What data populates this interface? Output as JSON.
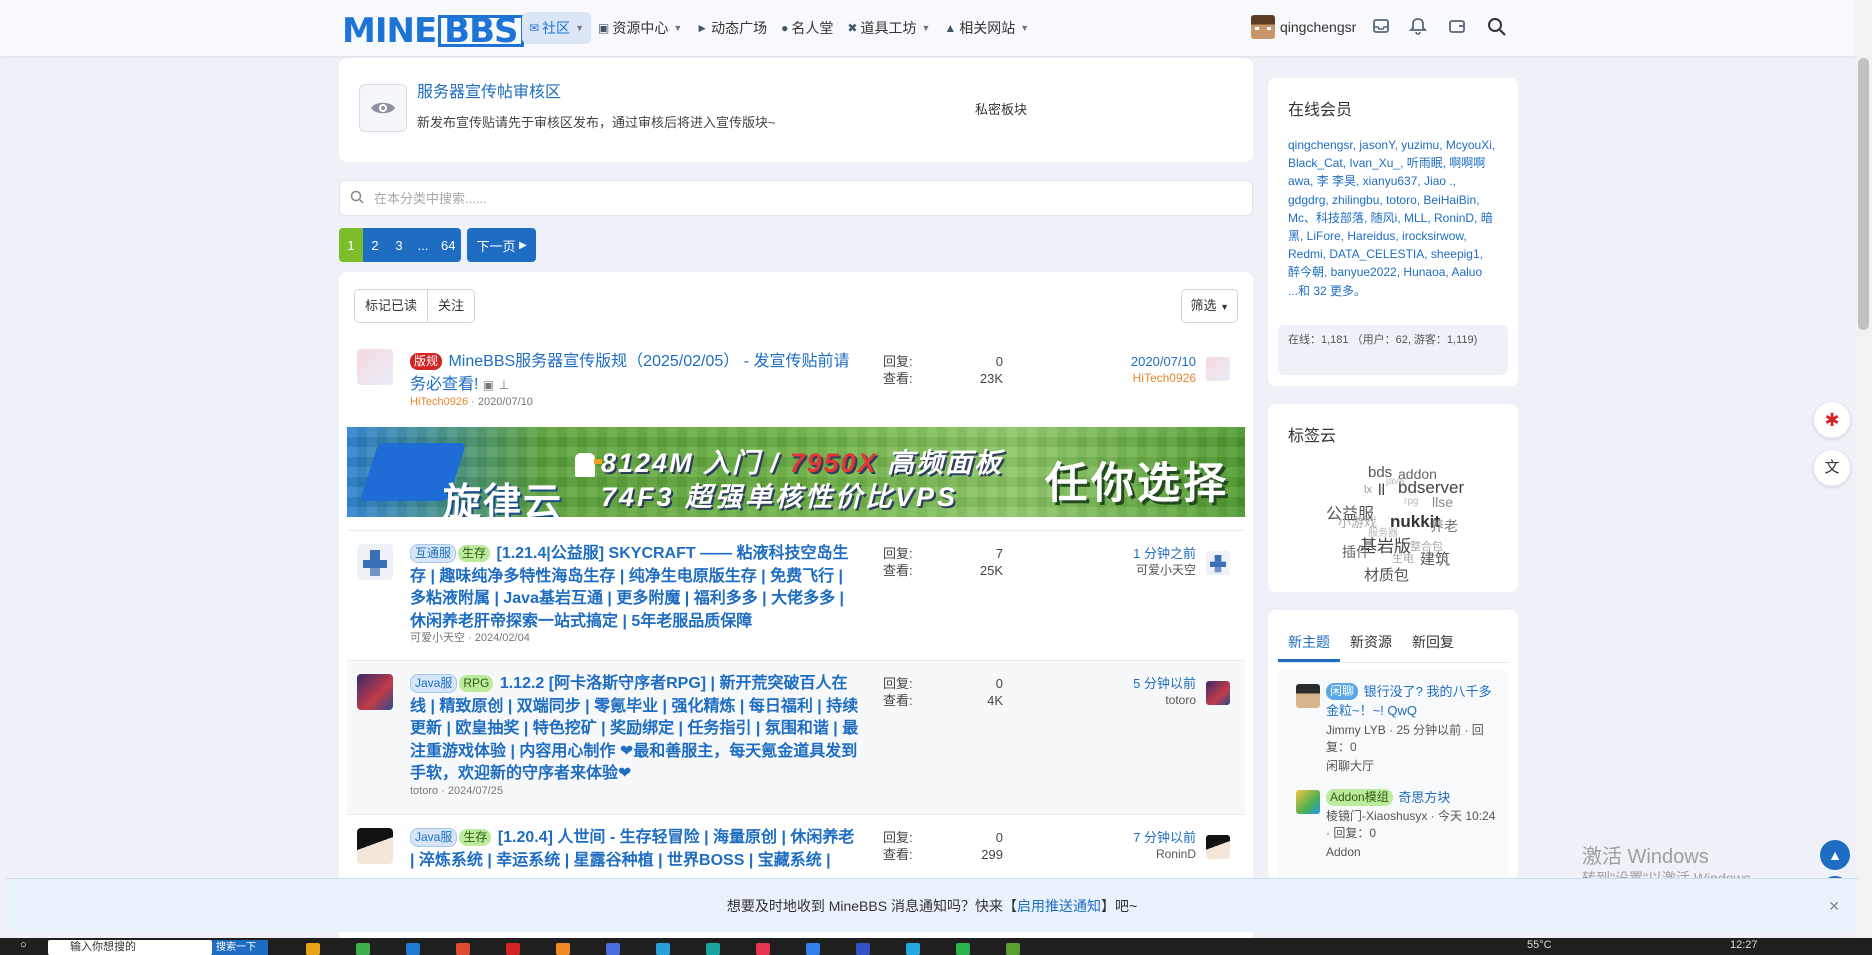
{
  "brand": {
    "logo_mine": "MINE",
    "logo_bbs": "BBS"
  },
  "nav": {
    "items": [
      {
        "label": "社区",
        "icon": "chat-icon",
        "active": true,
        "dropdown": true
      },
      {
        "label": "资源中心",
        "icon": "box-icon",
        "dropdown": true
      },
      {
        "label": "动态广场",
        "icon": "megaphone-icon"
      },
      {
        "label": "名人堂",
        "icon": "users-icon"
      },
      {
        "label": "道具工坊",
        "icon": "tools-icon",
        "dropdown": true
      },
      {
        "label": "相关网站",
        "icon": "sitemap-icon",
        "dropdown": true
      }
    ],
    "username": "qingchengsr"
  },
  "forum": {
    "title": "服务器宣传帖审核区",
    "description": "新发布宣传贴请先于审核区发布，通过审核后将进入宣传版块~",
    "private_label": "私密板块"
  },
  "search": {
    "placeholder": "在本分类中搜索......"
  },
  "pagination": {
    "current": "1",
    "pages": [
      "2",
      "3",
      "...",
      "64"
    ],
    "next": "下一页"
  },
  "thread_tools": {
    "mark_read": "标记已读",
    "follow": "关注",
    "filter": "筛选"
  },
  "labels": {
    "replies": "回复:",
    "views": "查看:"
  },
  "threads": [
    {
      "tags": [
        "版规"
      ],
      "title": "MineBBS服务器宣传版规（2025/02/05） - 发宣传贴前请务必查看!",
      "author": "HiTech0926",
      "date": "2020/07/10",
      "replies": "0",
      "views": "23K",
      "last_time": "2020/07/10",
      "last_user": "HiTech0926"
    },
    {
      "tags": [
        "互通服",
        "生存"
      ],
      "title": "[1.21.4|公益服] SKYCRAFT —— 粘液科技空岛生存 | 趣味纯净多特性海岛生存 | 纯净生电原版生存 | 免费飞行 | 多粘液附属 | Java基岩互通 | 更多附魔 | 福利多多 | 大佬多多 | 休闲养老肝帝探索一站式搞定 | 5年老服品质保障",
      "author": "可爱小天空",
      "date": "2024/02/04",
      "replies": "7",
      "views": "25K",
      "last_time": "1 分钟之前",
      "last_user": "可爱小天空"
    },
    {
      "tags": [
        "Java服",
        "RPG"
      ],
      "title": "1.12.2 [阿卡洛斯守序者RPG] | 新开荒突破百人在线 | 精致原创 | 双端同步 | 零氪毕业 | 强化精炼 | 每日福利 | 持续更新 | 欧皇抽奖 | 特色挖矿 | 奖励绑定 | 任务指引 | 氛围和谐 | 最注重游戏体验 | 内容用心制作 ❤最和善服主，每天氪金道具发到手软，欢迎新的守序者来体验❤",
      "author": "totoro",
      "date": "2024/07/25",
      "replies": "0",
      "views": "4K",
      "last_time": "5 分钟以前",
      "last_user": "totoro"
    },
    {
      "tags": [
        "Java服",
        "生存"
      ],
      "title": "[1.20.4] 人世间 - 生存轻冒险 | 海量原创 | 休闲养老 | 淬炼系统 | 幸运系统 | 星露谷种植 | 世界BOSS | 宝藏系统 |",
      "author": "RoninD",
      "date": "",
      "replies": "0",
      "views": "299",
      "last_time": "7 分钟以前",
      "last_user": "RoninD"
    }
  ],
  "banner": {
    "brand": "旋律云",
    "line1_a": "8124M 入门 / ",
    "line1_red": "7950X",
    "line1_b": " 高频面板",
    "line2": "74F3 超强单核性价比VPS",
    "right": "任你选择"
  },
  "sidebar": {
    "online": {
      "title": "在线会员",
      "members": "qingchengsr, jasonY, yuzimu, McyouXi, Black_Cat, Ivan_Xu_, 听雨眠, 啊啊啊awa, 李 李昊, xianyu637, Jiao ., gdgdrg, zhilingbu, totoro, BeiHaiBin, Mc、科技部落, 随风i, MLL, RoninD, 暗 黑, LiFore, Hareidus, irocksirwow, Redmi, DATA_CELESTIA, sheepig1, 醉今朝, banyue2022, Hunaoa, Aaluo",
      "more": "...和 32 更多。",
      "stats": "在线：1,181 （用户：62, 游客：1,119)"
    },
    "tagcloud": {
      "title": "标签云",
      "tags": [
        "bds",
        "addon",
        "lx",
        "ll",
        "bdserver",
        "java",
        "rpg",
        "llse",
        "公益服",
        "小游戏",
        "nukkit",
        "服务器",
        "养老",
        "基岩版",
        "插件",
        "整合包",
        "生电",
        "建筑",
        "材质包"
      ]
    },
    "tabs": [
      "新主题",
      "新资源",
      "新回复"
    ],
    "new_threads": [
      {
        "tag": "闲聊",
        "title": "银行没了? 我的八千多金粒~！~! QwQ",
        "meta1": "Jimmy LYB · 25 分钟以前 · 回复：0",
        "meta2": "闲聊大厅"
      },
      {
        "tag": "Addon模组",
        "title": "奇思方块",
        "meta1": "棱镜门-Xiaoshusyx · 今天 10:24 · 回复：0",
        "meta2": "Addon"
      }
    ]
  },
  "notification": {
    "text_a": "想要及时地收到 MineBBS 消息通知吗？快来【",
    "link": "启用推送通知",
    "text_b": "】吧~"
  },
  "watermark": {
    "line1": "激活 Windows",
    "line2": "转到\"设置\"以激活 Windows。"
  },
  "taskbar": {
    "search": "输入你想搜的",
    "search_btn": "搜索一下",
    "temp": "55°C",
    "time": "12:27"
  },
  "colors": {
    "accent": "#1e6dc2",
    "green": "#7bbd2b",
    "red_tag": "#d32323"
  }
}
